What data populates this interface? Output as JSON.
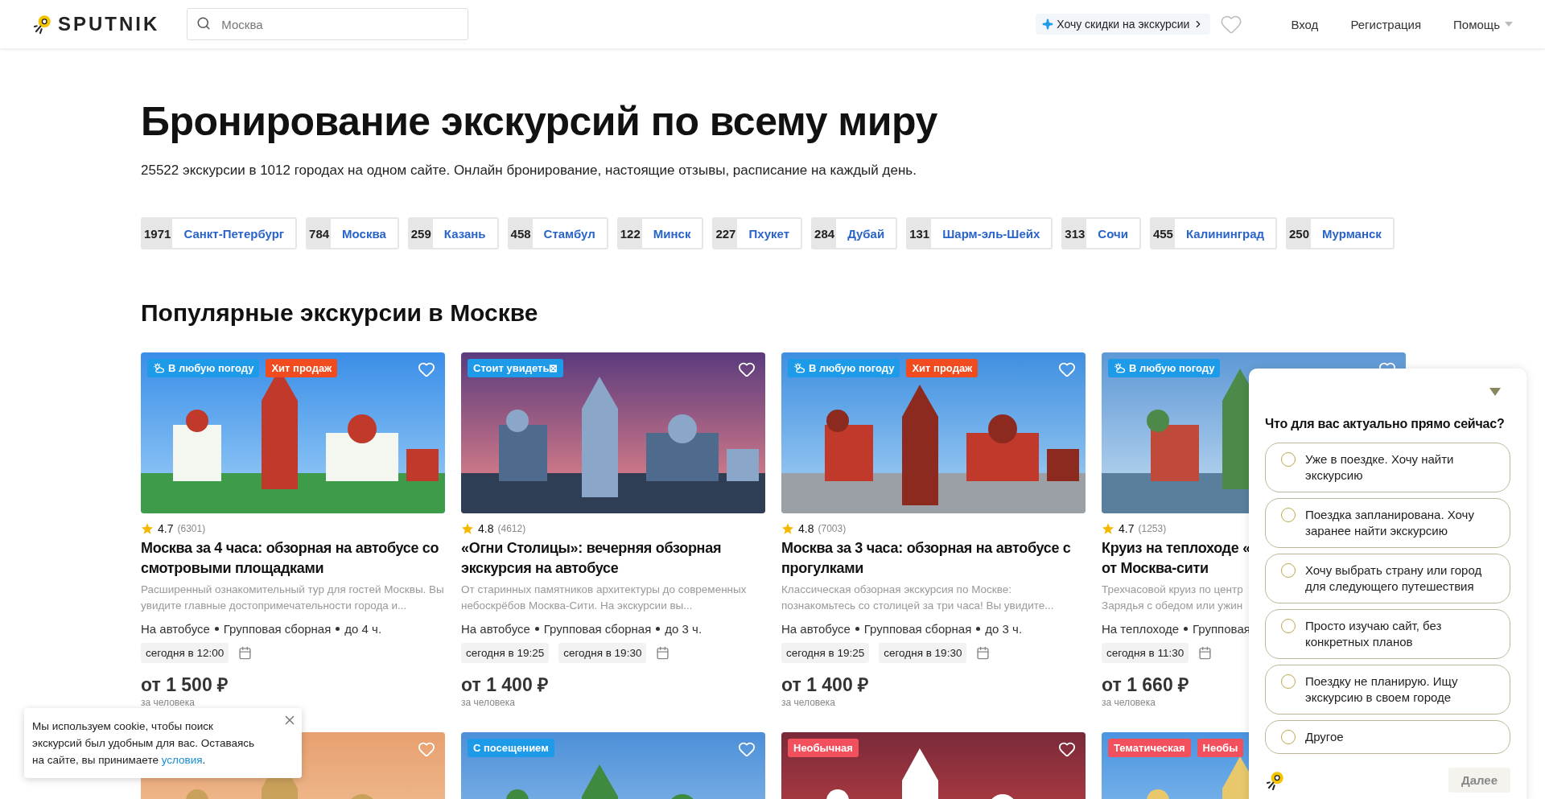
{
  "header": {
    "logo": "SPUTNIK",
    "search": {
      "placeholder": "Москва"
    },
    "promo": "Хочу скидки на экскурсии",
    "nav": [
      {
        "label": "Вход",
        "kind": "link"
      },
      {
        "label": "Регистрация",
        "kind": "link"
      },
      {
        "label": "Помощь",
        "kind": "dropdown"
      }
    ]
  },
  "hero": {
    "title": "Бронирование экскурсий по всему миру",
    "subtitle": "25522 экскурсии в 1012 городах на одном сайте. Онлайн бронирование, настоящие отзывы, расписание на каждый день.",
    "cities": [
      {
        "count": "1971",
        "name": "Санкт-Петербург"
      },
      {
        "count": "784",
        "name": "Москва"
      },
      {
        "count": "259",
        "name": "Казань"
      },
      {
        "count": "458",
        "name": "Стамбул"
      },
      {
        "count": "122",
        "name": "Минск"
      },
      {
        "count": "227",
        "name": "Пхукет"
      },
      {
        "count": "284",
        "name": "Дубай"
      },
      {
        "count": "131",
        "name": "Шарм-эль-Шейх"
      },
      {
        "count": "313",
        "name": "Сочи"
      },
      {
        "count": "455",
        "name": "Калининград"
      },
      {
        "count": "250",
        "name": "Мурманск"
      }
    ]
  },
  "section_title": "Популярные экскурсии в Москве",
  "cards": [
    {
      "badges": [
        {
          "label": "В любую погоду",
          "kind": "weather"
        },
        {
          "label": "Хит продаж",
          "kind": "hit"
        }
      ],
      "rating": "4.7",
      "reviews": "(6301)",
      "title": "Москва за 4 часа: обзорная на автобусе со смотровыми площадками",
      "description": "Расширенный ознакомительный тур для гостей Москвы. Вы увидите главные достопримечательности города и...",
      "meta": [
        "На автобусе",
        "Групповая сборная",
        "до 4 ч."
      ],
      "dates": [
        "сегодня в 12:00"
      ],
      "price": "от 1 500 ₽",
      "price_note": "за человека"
    },
    {
      "badges": [
        {
          "label": "Стоит увидеть⊠",
          "kind": "info"
        }
      ],
      "rating": "4.8",
      "reviews": "(4612)",
      "title": "«Огни Столицы»: вечерняя обзорная экскурсия на автобусе",
      "description": "От старинных памятников архитектуры до современных небоскрёбов Москва-Сити. На экскурсии вы...",
      "meta": [
        "На автобусе",
        "Групповая сборная",
        "до 3 ч."
      ],
      "dates": [
        "сегодня в 19:25",
        "сегодня в 19:30"
      ],
      "price": "от 1 400 ₽",
      "price_note": "за человека"
    },
    {
      "badges": [
        {
          "label": "В любую погоду",
          "kind": "weather"
        },
        {
          "label": "Хит продаж",
          "kind": "hit"
        }
      ],
      "rating": "4.8",
      "reviews": "(7003)",
      "title": "Москва за 3 часа: обзорная на автобусе с прогулками",
      "description": "Классическая обзорная экскурсия по Москве: познакомьтесь со столицей за три часа! Вы увидите...",
      "meta": [
        "На автобусе",
        "Групповая сборная",
        "до 3 ч."
      ],
      "dates": [
        "сегодня в 19:25",
        "сегодня в 19:30"
      ],
      "price": "от 1 400 ₽",
      "price_note": "за человека"
    },
    {
      "badges": [
        {
          "label": "В любую погоду",
          "kind": "weather"
        }
      ],
      "rating": "4.7",
      "reviews": "(1253)",
      "title": "Круиз на теплоходе «\nот Москва-сити",
      "description": "Трехчасовой круиз по центр\nЗарядья с обедом или ужин",
      "meta": [
        "На теплоходе",
        "Групповая"
      ],
      "dates": [
        "сегодня в 11:30"
      ],
      "price": "от 1 660 ₽",
      "price_note": "за человека"
    }
  ],
  "cards_row_2": [
    {
      "kind": "picture"
    },
    {
      "kind": "picture",
      "badges": [
        {
          "label": "С посещением",
          "kind": "info"
        }
      ]
    },
    {
      "kind": "picture",
      "badges": [
        {
          "label": "Необычная",
          "kind": "unusual"
        }
      ]
    },
    {
      "kind": "picture",
      "badges": [
        {
          "label": "Тематическая",
          "kind": "unusual"
        },
        {
          "label": "Необы",
          "kind": "unusual"
        }
      ]
    }
  ],
  "cookie": {
    "text": "Мы используем cookie, чтобы поиск экскурсий был удобным для вас. Оставаясь на сайте, вы принимаете ",
    "link": "условия",
    "end": "."
  },
  "survey": {
    "question": "Что для вас актуально прямо сейчас?",
    "options": [
      {
        "label": "Уже в поездке. Хочу найти экскурсию",
        "selected": false
      },
      {
        "label": "Поездка запланирована. Хочу заранее найти экскурсию",
        "selected": false
      },
      {
        "label": "Хочу выбрать страну или город для следующего путешествия",
        "selected": false
      },
      {
        "label": "Просто изучаю сайт, без конкретных планов",
        "selected": false
      },
      {
        "label": "Поездку не планирую. Ищу экскурсию в своем городе",
        "selected": false
      },
      {
        "label": "Другое",
        "selected": false
      }
    ],
    "next": {
      "label": "Далее",
      "disabled": true
    }
  }
}
